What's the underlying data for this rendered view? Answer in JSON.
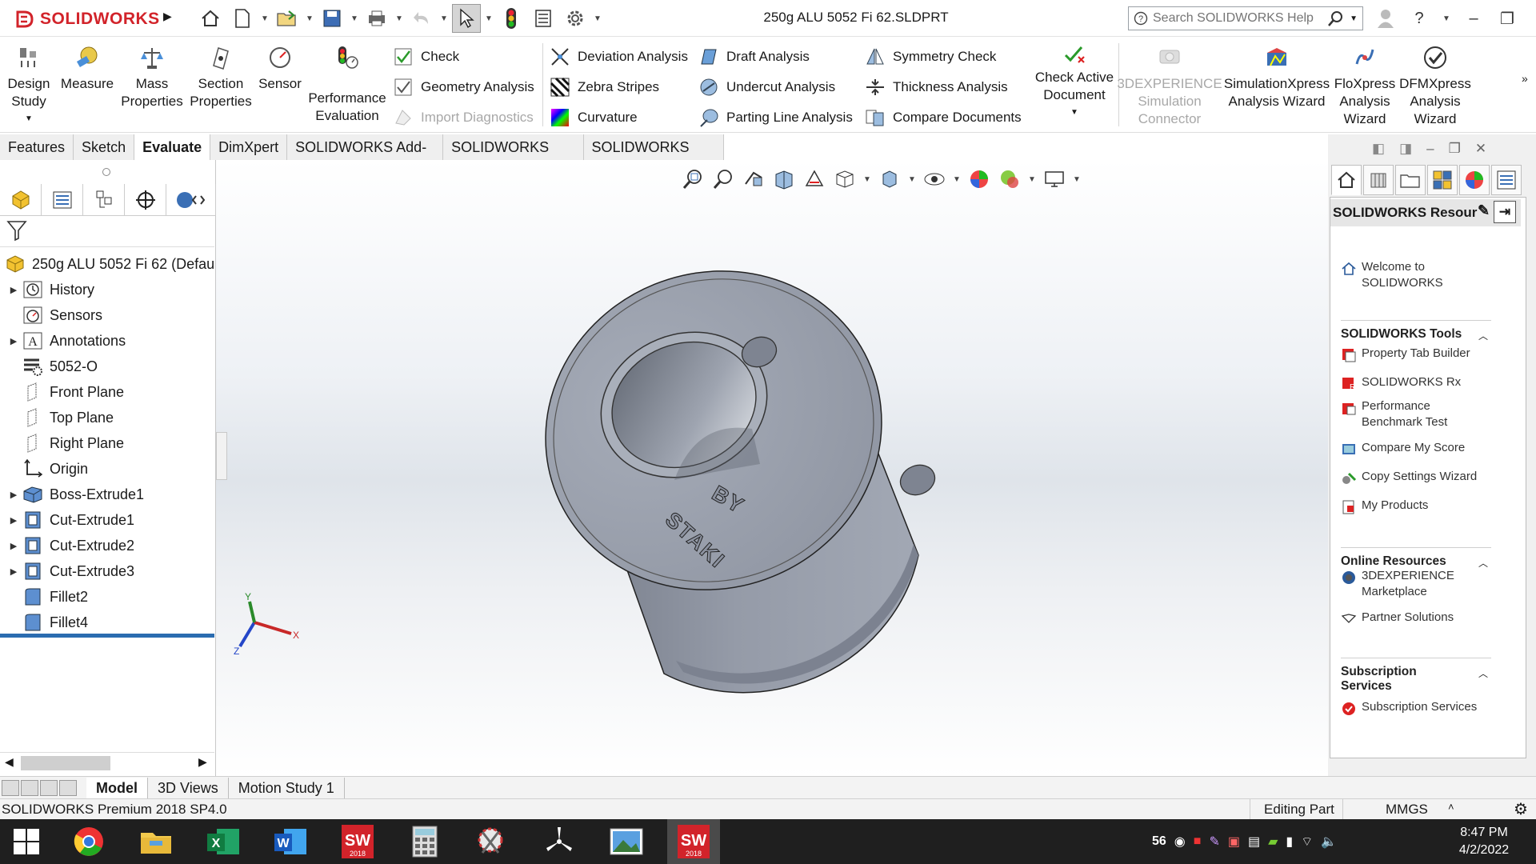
{
  "app": {
    "brand": "SOLIDWORKS",
    "doc_title": "250g ALU 5052 Fi 62.SLDPRT",
    "help_placeholder": "Search SOLIDWORKS Help"
  },
  "ribbon": {
    "big_left": [
      {
        "label": "Design\nStudy",
        "icon": "design-study-icon"
      },
      {
        "label": "Measure",
        "icon": "measure-icon"
      },
      {
        "label": "Mass\nProperties",
        "icon": "mass-properties-icon"
      },
      {
        "label": "Section\nProperties",
        "icon": "section-properties-icon"
      },
      {
        "label": "Sensor",
        "icon": "sensor-icon"
      },
      {
        "label": "Performance\nEvaluation",
        "icon": "performance-evaluation-icon"
      }
    ],
    "col1": [
      {
        "label": "Check",
        "disabled": false
      },
      {
        "label": "Geometry Analysis",
        "disabled": false
      },
      {
        "label": "Import Diagnostics",
        "disabled": true
      }
    ],
    "col2": [
      {
        "label": "Deviation Analysis"
      },
      {
        "label": "Zebra Stripes"
      },
      {
        "label": "Curvature"
      }
    ],
    "col3": [
      {
        "label": "Draft Analysis"
      },
      {
        "label": "Undercut Analysis"
      },
      {
        "label": "Parting Line Analysis"
      }
    ],
    "col4": [
      {
        "label": "Symmetry Check"
      },
      {
        "label": "Thickness Analysis"
      },
      {
        "label": "Compare Documents"
      }
    ],
    "check_active": "Check Active\nDocument",
    "big_right": [
      {
        "label": "3DEXPERIENCE\nSimulation\nConnector",
        "disabled": true
      },
      {
        "label": "SimulationXpress\nAnalysis Wizard",
        "disabled": false
      },
      {
        "label": "FloXpress\nAnalysis\nWizard",
        "disabled": false
      },
      {
        "label": "DFMXpress\nAnalysis\nWizard",
        "disabled": false
      }
    ]
  },
  "command_tabs": [
    "Features",
    "Sketch",
    "Evaluate",
    "DimXpert",
    "SOLIDWORKS Add-Ins",
    "SOLIDWORKS MBD",
    "SOLIDWORKS CAM"
  ],
  "active_command_tab": "Evaluate",
  "tree": {
    "root": "250g ALU 5052 Fi 62  (Defau",
    "items": [
      {
        "label": "History",
        "expandable": true
      },
      {
        "label": "Sensors",
        "expandable": false
      },
      {
        "label": "Annotations",
        "expandable": true
      },
      {
        "label": "5052-O",
        "expandable": false
      },
      {
        "label": "Front Plane",
        "expandable": false
      },
      {
        "label": "Top Plane",
        "expandable": false
      },
      {
        "label": "Right Plane",
        "expandable": false
      },
      {
        "label": "Origin",
        "expandable": false
      },
      {
        "label": "Boss-Extrude1",
        "expandable": true
      },
      {
        "label": "Cut-Extrude1",
        "expandable": true
      },
      {
        "label": "Cut-Extrude2",
        "expandable": true
      },
      {
        "label": "Cut-Extrude3",
        "expandable": true
      },
      {
        "label": "Fillet2",
        "expandable": false
      },
      {
        "label": "Fillet4",
        "expandable": false
      }
    ]
  },
  "model": {
    "engraving_1": "BY",
    "engraving_2": "STAKI"
  },
  "taskpane": {
    "title": "SOLIDWORKS Resour",
    "welcome": "Welcome to\nSOLIDWORKS",
    "sections": [
      {
        "title": "SOLIDWORKS Tools",
        "items": [
          "Property Tab Builder",
          "SOLIDWORKS Rx",
          "Performance\nBenchmark Test",
          "Compare My Score",
          "Copy Settings Wizard",
          "My Products"
        ]
      },
      {
        "title": "Online Resources",
        "items": [
          "3DEXPERIENCE\nMarketplace",
          "Partner Solutions"
        ]
      },
      {
        "title": "Subscription\nServices",
        "items": [
          "Subscription Services"
        ]
      }
    ]
  },
  "model_tabs": [
    "Model",
    "3D Views",
    "Motion Study 1"
  ],
  "active_model_tab": "Model",
  "status": {
    "product": "SOLIDWORKS Premium 2018 SP4.0",
    "mode": "Editing Part",
    "units": "MMGS"
  },
  "taskbar": {
    "tray_badge": "56",
    "time": "8:47 PM",
    "date": "4/2/2022"
  },
  "colors": {
    "brand_red": "#d2232a",
    "part_gray": "#9096a4",
    "selection_blue": "#2b6cb0"
  }
}
